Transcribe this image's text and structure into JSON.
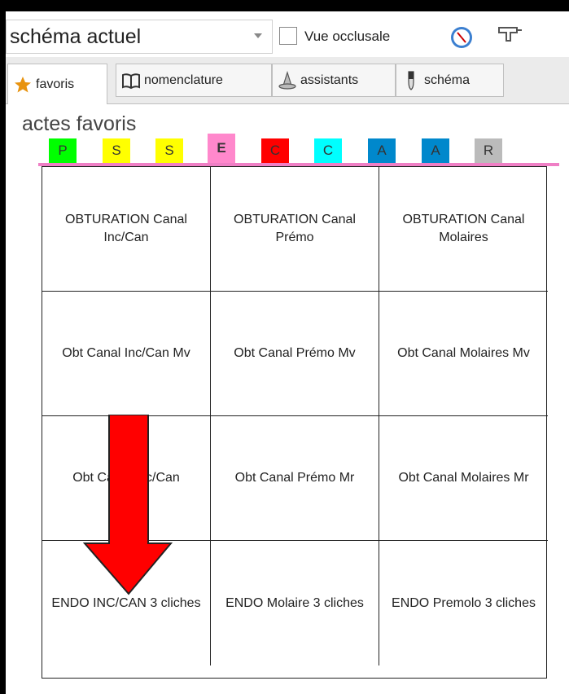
{
  "toolbar": {
    "combo_value": "schéma actuel",
    "checkbox_label": "Vue occlusale",
    "checkbox_checked": false
  },
  "tabs": [
    {
      "label": "favoris",
      "icon": "star-icon",
      "active": true
    },
    {
      "label": "nomenclature",
      "icon": "book-icon",
      "active": false
    },
    {
      "label": "assistants",
      "icon": "wizard-hat-icon",
      "active": false
    },
    {
      "label": "schéma",
      "icon": "tooth-icon",
      "active": false
    }
  ],
  "content": {
    "section_title": "actes favoris",
    "categories": [
      {
        "label": "P",
        "color": "#00ff00",
        "active": false
      },
      {
        "label": "S",
        "color": "#ffff00",
        "active": false
      },
      {
        "label": "S",
        "color": "#ffff00",
        "active": false
      },
      {
        "label": "E",
        "color": "#ff88cc",
        "active": true
      },
      {
        "label": "C",
        "color": "#ff0000",
        "active": false
      },
      {
        "label": "C",
        "color": "#00ffff",
        "active": false
      },
      {
        "label": "A",
        "color": "#0088cc",
        "active": false
      },
      {
        "label": "A",
        "color": "#0088cc",
        "active": false
      },
      {
        "label": "R",
        "color": "#bbbbbb",
        "active": false
      }
    ],
    "cells": [
      "OBTURATION Canal Inc/Can",
      "OBTURATION Canal Prémo",
      "OBTURATION Canal Molaires",
      "Obt Canal Inc/Can Mv",
      "Obt Canal Prémo Mv",
      "Obt Canal Molaires Mv",
      "Obt Canal Inc/Can",
      "Obt Canal Prémo Mr",
      "Obt Canal Molaires Mr",
      "ENDO INC/CAN 3 cliches",
      "ENDO Molaire 3 cliches",
      "ENDO Premolo 3 cliches"
    ]
  },
  "colors": {
    "accent_pink": "#ef7fc5",
    "arrow_red": "#ff0000"
  }
}
